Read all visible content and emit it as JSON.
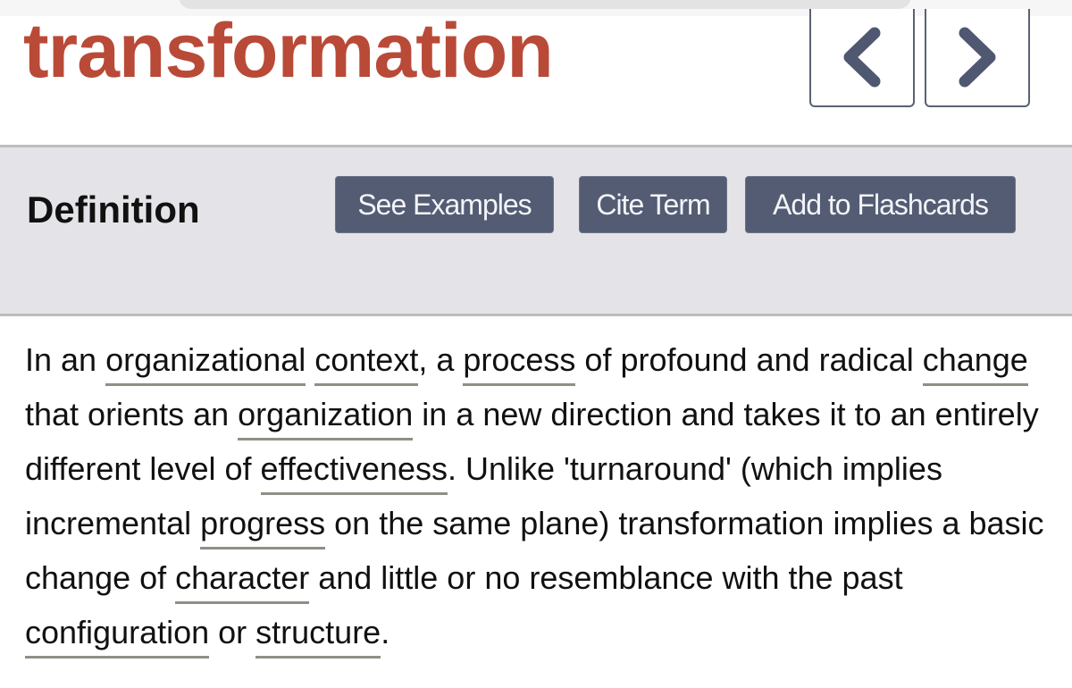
{
  "term": {
    "title": "transformation",
    "title_color": "#b94a38"
  },
  "nav": {
    "prev_icon": "chevron-left-icon",
    "next_icon": "chevron-right-icon"
  },
  "definition_bar": {
    "label": "Definition",
    "buttons": [
      {
        "label": "See Examples"
      },
      {
        "label": "Cite Term"
      },
      {
        "label": "Add to Flashcards"
      }
    ],
    "button_color": "#535c73"
  },
  "definition": {
    "segments": [
      {
        "t": "In an "
      },
      {
        "t": "organizational",
        "link": true
      },
      {
        "t": " "
      },
      {
        "t": "context",
        "link": true
      },
      {
        "t": ", a "
      },
      {
        "t": "process",
        "link": true
      },
      {
        "t": " of profound and radical "
      },
      {
        "t": "change",
        "link": true
      },
      {
        "t": " that orients an "
      },
      {
        "t": "organization",
        "link": true
      },
      {
        "t": " in a new direction and takes it to an entirely different level of "
      },
      {
        "t": "effectiveness",
        "link": true
      },
      {
        "t": ". Unlike 'turnaround' (which implies incremental "
      },
      {
        "t": "progress",
        "link": true
      },
      {
        "t": " on the same plane) transformation implies a basic change of "
      },
      {
        "t": "character",
        "link": true
      },
      {
        "t": " and little or no resemblance with the past "
      },
      {
        "t": "configuration",
        "link": true
      },
      {
        "t": " or "
      },
      {
        "t": "structure",
        "link": true
      },
      {
        "t": "."
      }
    ]
  }
}
